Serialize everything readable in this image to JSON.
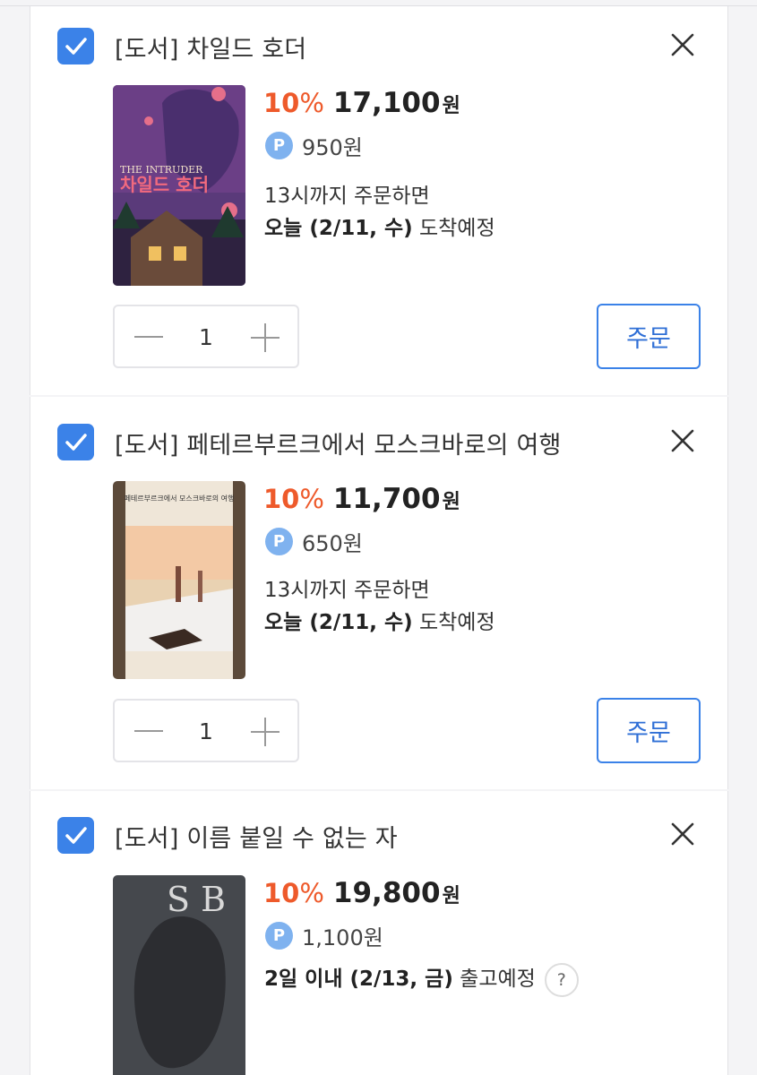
{
  "items": [
    {
      "title": "[도서] 차일드 호더",
      "discount": "10",
      "discount_unit": "%",
      "price": "17,100",
      "price_unit": "원",
      "point": "950원",
      "cutoff": "13시까지 주문하면",
      "delivery_bold": "오늘 (2/11, 수)",
      "delivery_rest": " 도착예정",
      "quantity": "1",
      "order_label": "주문",
      "cover_text_en": "THE INTRUDER",
      "cover_text_ko": "차일드 호더"
    },
    {
      "title": "[도서] 페테르부르크에서 모스크바로의 여행",
      "discount": "10",
      "discount_unit": "%",
      "price": "11,700",
      "price_unit": "원",
      "point": "650원",
      "cutoff": "13시까지 주문하면",
      "delivery_bold": "오늘 (2/11, 수)",
      "delivery_rest": " 도착예정",
      "quantity": "1",
      "order_label": "주문",
      "cover_text_ko": "페테르부르크에서 모스크바로의 여행"
    },
    {
      "title": "[도서] 이름 붙일 수 없는 자",
      "discount": "10",
      "discount_unit": "%",
      "price": "19,800",
      "price_unit": "원",
      "point": "1,100원",
      "delivery_bold": "2일 이내 (2/13, 금)",
      "delivery_rest": " 출고예정",
      "help_label": "?",
      "cover_text": "S B"
    }
  ],
  "colors": {
    "accent": "#3b82e8",
    "discount": "#ee5a2b",
    "point_badge": "#7fb2ef",
    "point_letter": "P"
  },
  "icons": [
    "checkbox-checked-icon",
    "close-icon",
    "point-icon",
    "minus-icon",
    "plus-icon",
    "help-icon"
  ]
}
